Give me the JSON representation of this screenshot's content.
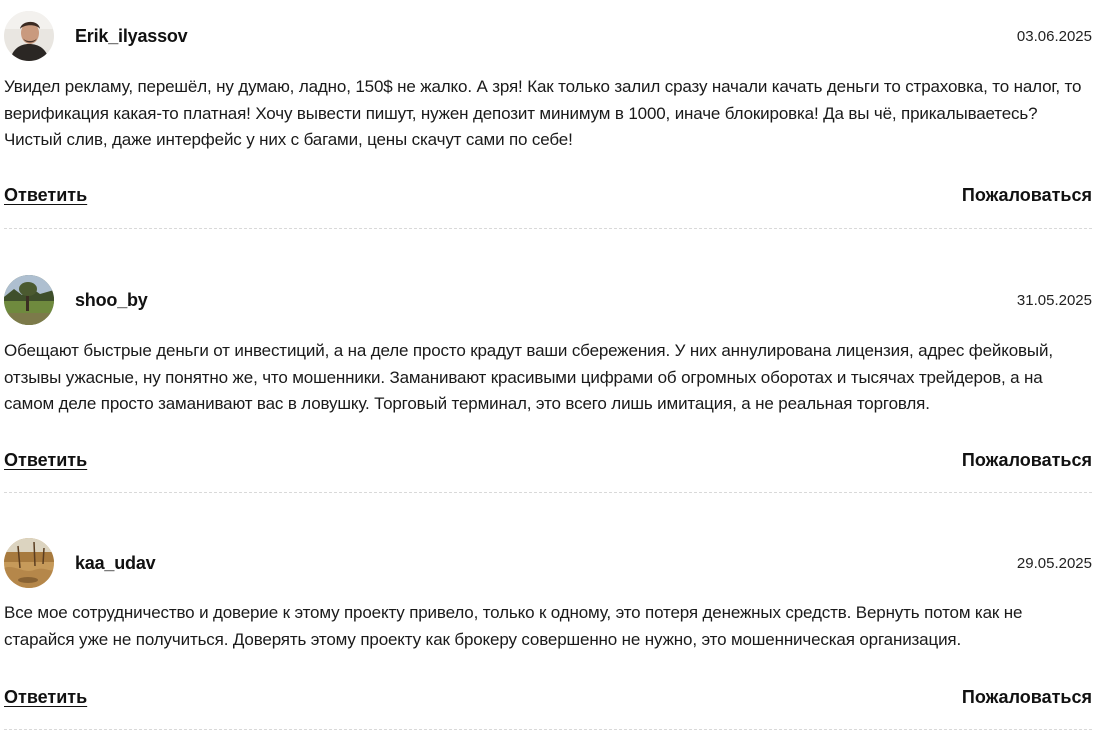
{
  "comments": [
    {
      "username": "Erik_ilyassov",
      "date": "03.06.2025",
      "text": "Увидел рекламу, перешёл, ну думаю, ладно, 150$ не жалко. А зря! Как только залил сразу начали качать деньги то страховка, то налог, то верификация какая-то платная! Хочу вывести пишут, нужен депозит минимум в 1000, иначе блокировка! Да вы чё, прикалываетесь? Чистый слив, даже интерфейс у них с багами, цены скачут сами по себе!",
      "reply_label": "Ответить",
      "report_label": "Пожаловаться"
    },
    {
      "username": "shoo_by",
      "date": "31.05.2025",
      "text": "Обещают быстрые деньги от инвестиций, а на деле просто крадут ваши сбережения. У них аннулирована лицензия, адрес фейковый, отзывы ужасные, ну понятно же, что мошенники. Заманивают красивыми цифрами об огромных оборотах и тысячах трейдеров, а на самом деле просто заманивают вас в ловушку. Торговый терминал, это всего лишь имитация, а не реальная торговля.",
      "reply_label": "Ответить",
      "report_label": "Пожаловаться"
    },
    {
      "username": "kaa_udav",
      "date": "29.05.2025",
      "text": "Все мое сотрудничество и доверие к этому проекту привело, только к одному, это потеря денежных средств. Вернуть потом как не старайся уже не получиться. Доверять этому проекту как брокеру совершенно не нужно, это мошенническая организация.",
      "reply_label": "Ответить",
      "report_label": "Пожаловаться"
    }
  ]
}
